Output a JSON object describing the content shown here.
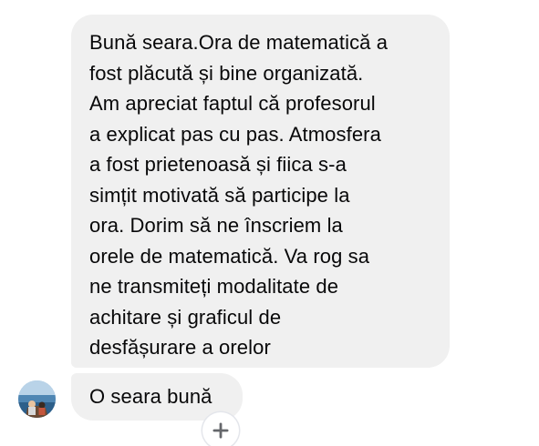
{
  "messages": [
    {
      "sender": "me",
      "text": "Bună seara.Ora de matematică a\nfost plăcută și bine organizată.\nAm apreciat faptul că profesorul\na explicat pas cu pas. Atmosfera\na fost prietenoasă și fiica s-a\nsimțit motivată să participe la\nora. Dorim să ne înscriem la\norele de matematică. Va rog sa\nne transmiteți modalitate de\nachitare și graficul de\ndesfășurare a orelor"
    },
    {
      "sender": "contact",
      "text": "O seara bună"
    }
  ],
  "icons": {
    "avatar": "avatar-beach-photo",
    "add_reaction": "plus-icon"
  },
  "colors": {
    "bubble_bg": "#f0f0f0",
    "text": "#080809",
    "reaction_icon": "#65676b"
  }
}
